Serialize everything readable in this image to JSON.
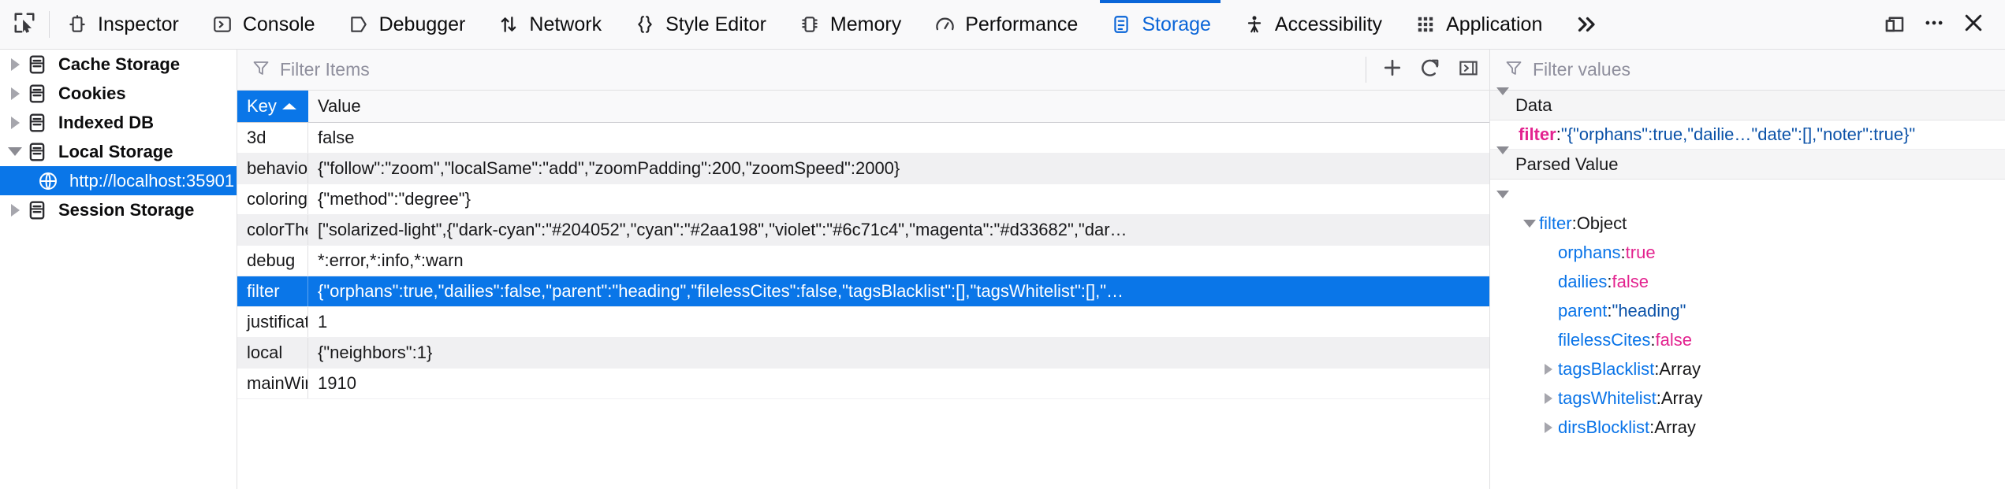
{
  "toolbar": {
    "picker_icon": "element-picker-icon",
    "tabs": [
      {
        "label": "Inspector",
        "icon": "inspector-icon",
        "selected": false
      },
      {
        "label": "Console",
        "icon": "console-icon",
        "selected": false
      },
      {
        "label": "Debugger",
        "icon": "debugger-icon",
        "selected": false
      },
      {
        "label": "Network",
        "icon": "network-icon",
        "selected": false
      },
      {
        "label": "Style Editor",
        "icon": "style-editor-icon",
        "selected": false
      },
      {
        "label": "Memory",
        "icon": "memory-icon",
        "selected": false
      },
      {
        "label": "Performance",
        "icon": "performance-icon",
        "selected": false
      },
      {
        "label": "Storage",
        "icon": "storage-icon",
        "selected": true
      },
      {
        "label": "Accessibility",
        "icon": "accessibility-icon",
        "selected": false
      },
      {
        "label": "Application",
        "icon": "application-icon",
        "selected": false
      }
    ],
    "overflow_icon": "chevron-double-right-icon",
    "dock_icon": "dock-split-icon",
    "meatball_icon": "ellipsis-icon",
    "close_icon": "close-icon",
    "accent": "#0a65d8"
  },
  "tree": {
    "items": [
      {
        "label": "Cache Storage",
        "expanded": false,
        "selected": false,
        "child": false,
        "icon": "database-icon"
      },
      {
        "label": "Cookies",
        "expanded": false,
        "selected": false,
        "child": false,
        "icon": "database-icon"
      },
      {
        "label": "Indexed DB",
        "expanded": false,
        "selected": false,
        "child": false,
        "icon": "database-icon"
      },
      {
        "label": "Local Storage",
        "expanded": true,
        "selected": false,
        "child": false,
        "icon": "database-icon"
      },
      {
        "label": "http://localhost:35901",
        "expanded": null,
        "selected": true,
        "child": true,
        "icon": "globe-icon"
      },
      {
        "label": "Session Storage",
        "expanded": false,
        "selected": false,
        "child": false,
        "icon": "database-icon"
      }
    ]
  },
  "items_panel": {
    "filter_placeholder": "Filter Items",
    "filter_icon": "funnel-icon",
    "add_icon": "plus-icon",
    "refresh_icon": "refresh-icon",
    "sidebar_toggle_icon": "panel-toggle-icon",
    "columns": [
      {
        "key": "key",
        "label": "Key",
        "sorted": true,
        "sort_dir": "asc"
      },
      {
        "key": "value",
        "label": "Value",
        "sorted": false,
        "sort_dir": ""
      }
    ],
    "rows": [
      {
        "key": "3d",
        "value": "false",
        "selected": false
      },
      {
        "key": "behavior",
        "value": "{\"follow\":\"zoom\",\"localSame\":\"add\",\"zoomPadding\":200,\"zoomSpeed\":2000}",
        "selected": false
      },
      {
        "key": "coloring",
        "value": "{\"method\":\"degree\"}",
        "selected": false
      },
      {
        "key": "colorThe…",
        "value": "[\"solarized-light\",{\"dark-cyan\":\"#204052\",\"cyan\":\"#2aa198\",\"violet\":\"#6c71c4\",\"magenta\":\"#d33682\",\"dar…",
        "selected": false
      },
      {
        "key": "debug",
        "value": "*:error,*:info,*:warn",
        "selected": false
      },
      {
        "key": "filter",
        "value": "{\"orphans\":true,\"dailies\":false,\"parent\":\"heading\",\"filelessCites\":false,\"tagsBlacklist\":[],\"tagsWhitelist\":[],\"…",
        "selected": true
      },
      {
        "key": "justificati…",
        "value": "1",
        "selected": false
      },
      {
        "key": "local",
        "value": "{\"neighbors\":1}",
        "selected": false
      },
      {
        "key": "mainWin…",
        "value": "1910",
        "selected": false
      }
    ]
  },
  "value_panel": {
    "filter_placeholder": "Filter values",
    "filter_icon": "funnel-icon",
    "sections": [
      {
        "title": "Data",
        "expanded": true
      },
      {
        "title": "Parsed Value",
        "expanded": true
      }
    ],
    "data_entry": {
      "name": "filter",
      "separator": ":",
      "value": "\"{\"orphans\":true,\"dailie…\"date\":[],\"noter\":true}\""
    },
    "parsed": {
      "root_expanded": true,
      "nodes": [
        {
          "depth": 1,
          "twisty": "down",
          "name": "filter",
          "sep": ":",
          "value": "Object",
          "vtype": "type"
        },
        {
          "depth": 2,
          "twisty": "none",
          "name": "orphans",
          "sep": ":",
          "value": "true",
          "vtype": "bool"
        },
        {
          "depth": 2,
          "twisty": "none",
          "name": "dailies",
          "sep": ":",
          "value": "false",
          "vtype": "bool"
        },
        {
          "depth": 2,
          "twisty": "none",
          "name": "parent",
          "sep": ":",
          "value": "\"heading\"",
          "vtype": "str"
        },
        {
          "depth": 2,
          "twisty": "none",
          "name": "filelessCites",
          "sep": ":",
          "value": "false",
          "vtype": "bool"
        },
        {
          "depth": 2,
          "twisty": "right",
          "name": "tagsBlacklist",
          "sep": ":",
          "value": "Array",
          "vtype": "type"
        },
        {
          "depth": 2,
          "twisty": "right",
          "name": "tagsWhitelist",
          "sep": ":",
          "value": "Array",
          "vtype": "type"
        },
        {
          "depth": 2,
          "twisty": "right",
          "name": "dirsBlocklist",
          "sep": ":",
          "value": "Array",
          "vtype": "type"
        }
      ]
    }
  }
}
